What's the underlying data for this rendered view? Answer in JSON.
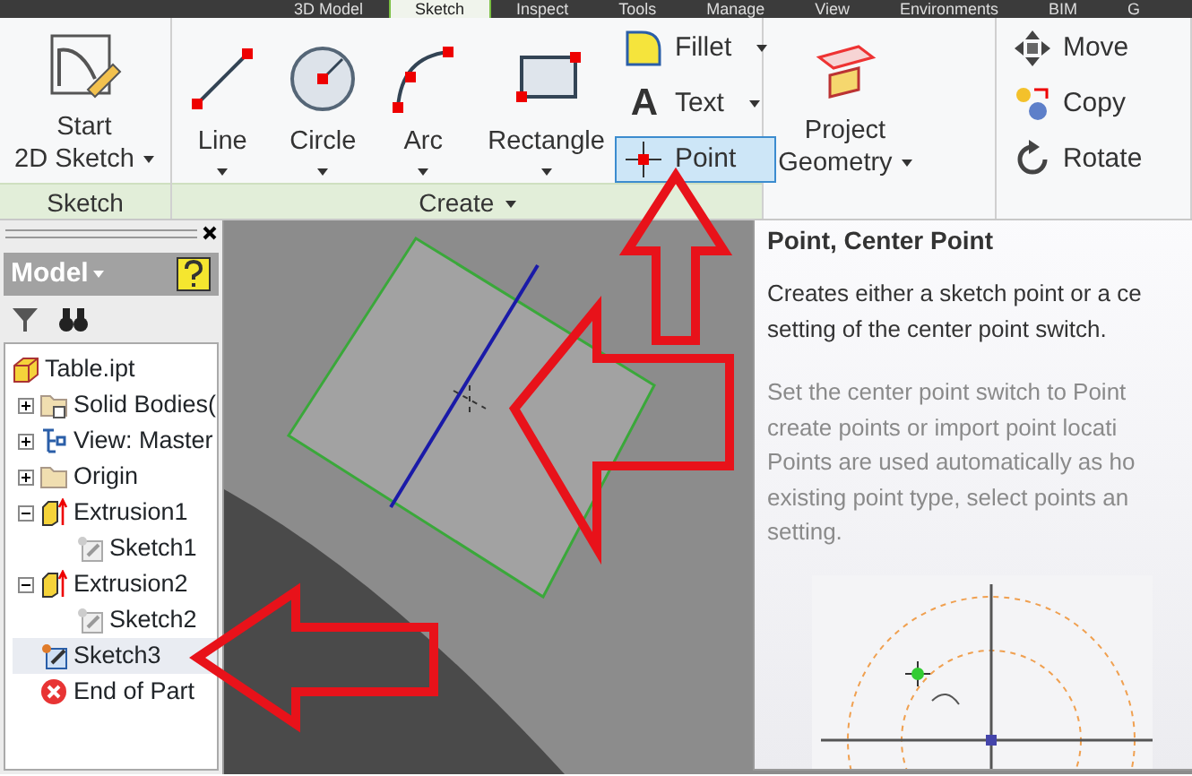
{
  "ribbon_tabs": [
    {
      "label": "3D Model",
      "selected": false
    },
    {
      "label": "Sketch",
      "selected": true
    },
    {
      "label": "Inspect",
      "selected": false
    },
    {
      "label": "Tools",
      "selected": false
    },
    {
      "label": "Manage",
      "selected": false
    },
    {
      "label": "View",
      "selected": false
    },
    {
      "label": "Environments",
      "selected": false
    },
    {
      "label": "BIM",
      "selected": false
    },
    {
      "label": "G",
      "selected": false
    }
  ],
  "sketch_panel": {
    "label": "Sketch",
    "button_lines": [
      "Start",
      "2D Sketch"
    ]
  },
  "create_panel": {
    "label": "Create",
    "large_tools": [
      {
        "kind": "line",
        "label": "Line"
      },
      {
        "kind": "circle",
        "label": "Circle"
      },
      {
        "kind": "arc",
        "label": "Arc"
      },
      {
        "kind": "rectangle",
        "label": "Rectangle"
      }
    ],
    "small_tools": [
      {
        "kind": "fillet",
        "label": "Fillet",
        "selected": false
      },
      {
        "kind": "text",
        "label": "Text",
        "glyph": "A",
        "selected": false
      },
      {
        "kind": "point",
        "label": "Point",
        "selected": true
      }
    ]
  },
  "project_panel": {
    "button_lines": [
      "Project",
      "Geometry"
    ]
  },
  "modify_tools": [
    {
      "kind": "move",
      "label": "Move"
    },
    {
      "kind": "copy",
      "label": "Copy"
    },
    {
      "kind": "rotate",
      "label": "Rotate"
    }
  ],
  "browser": {
    "title": "Model",
    "tree": [
      {
        "kind": "part",
        "label": "Table.ipt",
        "selected": false,
        "children": [
          {
            "kind": "bodies",
            "label": "Solid Bodies(",
            "expanded": false,
            "selected": false
          },
          {
            "kind": "view",
            "label": "View: Master",
            "expanded": false,
            "selected": false
          },
          {
            "kind": "folder",
            "label": "Origin",
            "expanded": false,
            "selected": false
          },
          {
            "kind": "extrusion",
            "label": "Extrusion1",
            "expanded": true,
            "selected": false,
            "children": [
              {
                "kind": "sketch",
                "label": "Sketch1",
                "selected": false
              }
            ]
          },
          {
            "kind": "extrusion",
            "label": "Extrusion2",
            "expanded": true,
            "selected": false,
            "children": [
              {
                "kind": "sketch",
                "label": "Sketch2",
                "selected": false
              }
            ]
          },
          {
            "kind": "active-sketch",
            "label": "Sketch3",
            "selected": true
          },
          {
            "kind": "end",
            "label": "End of Part",
            "selected": false
          }
        ]
      }
    ]
  },
  "tooltip": {
    "title": "Point, Center Point",
    "summary_lines": [
      "Creates either a sketch point or a ce",
      "setting of the center point switch."
    ],
    "detail_lines": [
      "Set the center point switch to Point",
      "create points or import point locati",
      "Points are used automatically as ho",
      "existing point type, select points an",
      "setting."
    ]
  }
}
